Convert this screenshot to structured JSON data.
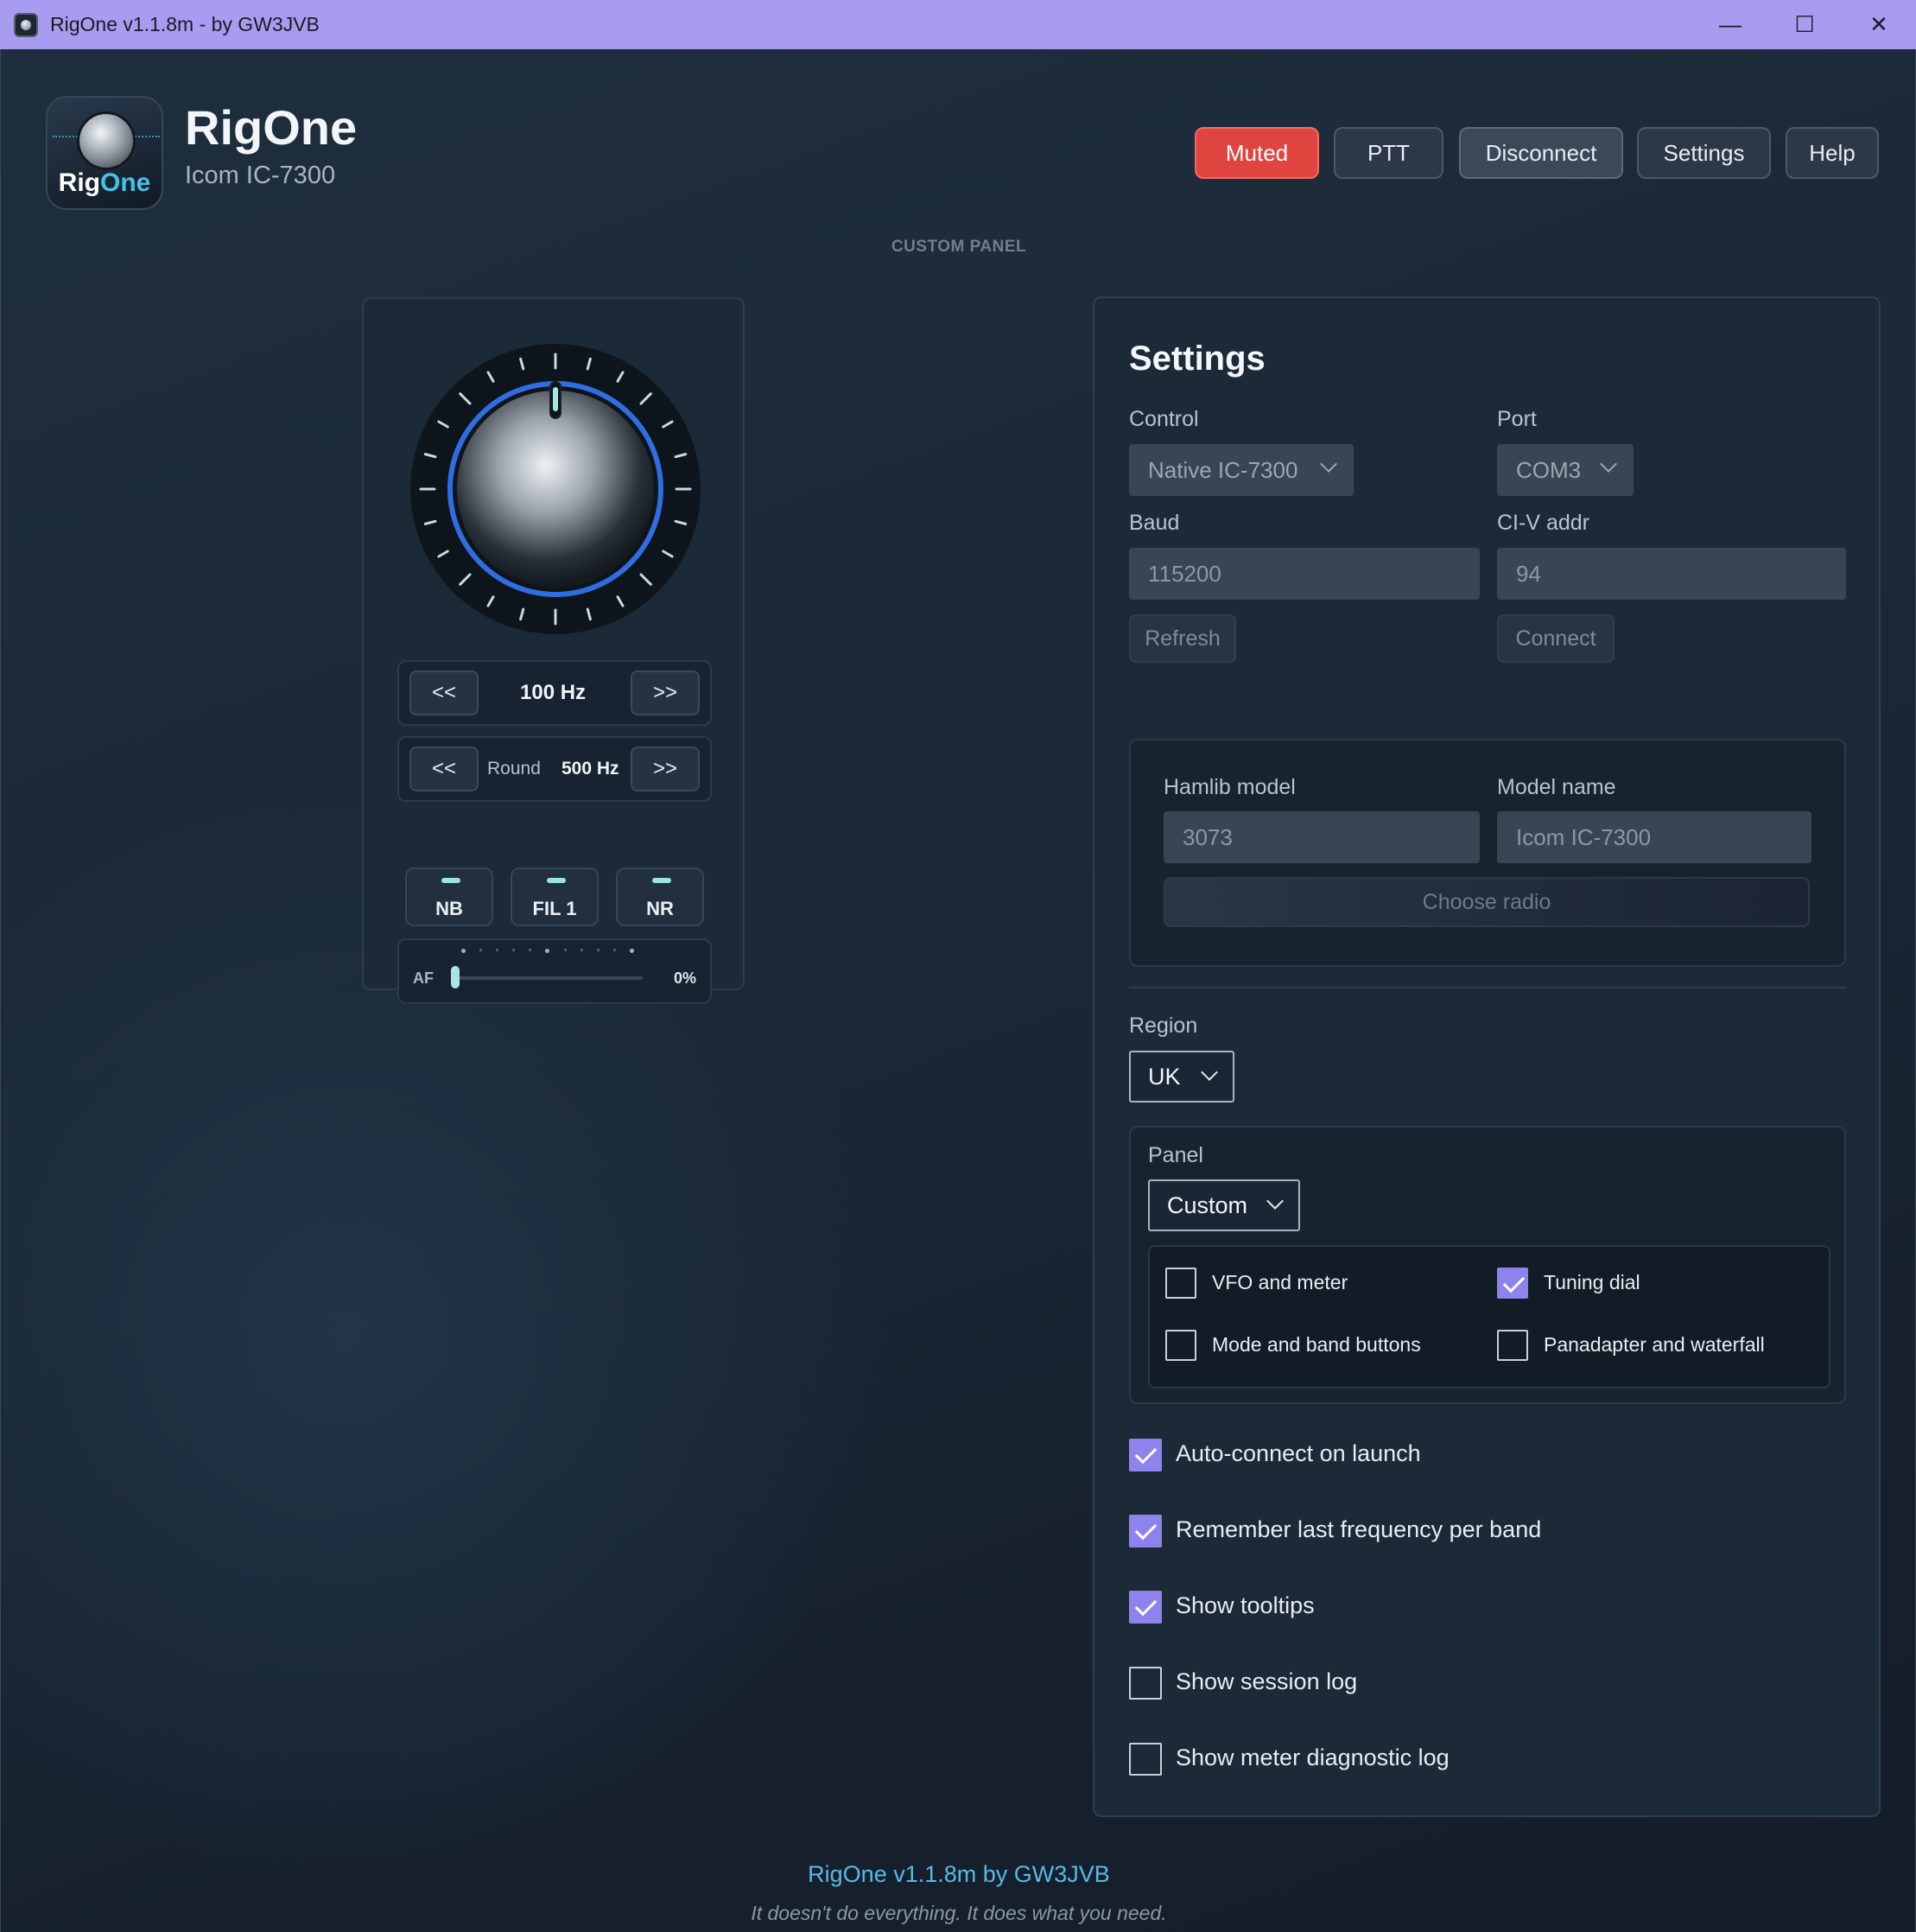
{
  "titlebar": {
    "title": "RigOne v1.1.8m - by GW3JVB",
    "icon": "app-icon",
    "minimize": "—",
    "maximize": "☐",
    "close": "✕"
  },
  "header": {
    "logo_text_a": "Rig",
    "logo_text_b": "One",
    "app_name": "RigOne",
    "radio_model": "Icom IC-7300",
    "buttons": {
      "muted": "Muted",
      "ptt": "PTT",
      "disconnect": "Disconnect",
      "settings": "Settings",
      "help": "Help"
    },
    "muted_color": "#e0443f"
  },
  "section_caption": "CUSTOM PANEL",
  "custom_panel": {
    "step_left": "<<",
    "step_right": ">>",
    "step_value": "100 Hz",
    "round_label": "Round",
    "round_value": "500 Hz",
    "toggles": [
      "NB",
      "FIL 1",
      "NR"
    ],
    "af_label": "AF",
    "af_value": "0%",
    "af_level": 0
  },
  "settings": {
    "title": "Settings",
    "control_label": "Control",
    "control_value": "Native IC-7300",
    "port_label": "Port",
    "port_value": "COM3",
    "baud_label": "Baud",
    "baud_value": "115200",
    "civ_label": "CI-V addr",
    "civ_value": "94",
    "refresh": "Refresh",
    "connect": "Connect",
    "hamlib_model_label": "Hamlib model",
    "hamlib_model_value": "3073",
    "model_name_label": "Model name",
    "model_name_value": "Icom IC-7300",
    "choose_radio": "Choose radio",
    "region_label": "Region",
    "region_value": "UK",
    "panel_label": "Panel",
    "panel_value": "Custom",
    "panel_options": {
      "vfo_meter": {
        "label": "VFO and meter",
        "checked": false
      },
      "tuning_dial": {
        "label": "Tuning dial",
        "checked": true
      },
      "mode_band": {
        "label": "Mode and band buttons",
        "checked": false
      },
      "panadapter": {
        "label": "Panadapter and waterfall",
        "checked": false
      }
    },
    "options": {
      "auto_connect": {
        "label": "Auto-connect on launch",
        "checked": true
      },
      "remember_freq": {
        "label": "Remember last frequency per band",
        "checked": true
      },
      "tooltips": {
        "label": "Show tooltips",
        "checked": true
      },
      "session_log": {
        "label": "Show session log",
        "checked": false
      },
      "meter_log": {
        "label": "Show meter diagnostic log",
        "checked": false
      }
    },
    "accent_color": "#8e82ec"
  },
  "footer": {
    "version": "RigOne v1.1.8m by GW3JVB",
    "tagline": "It doesn't do everything. It does what you need."
  }
}
